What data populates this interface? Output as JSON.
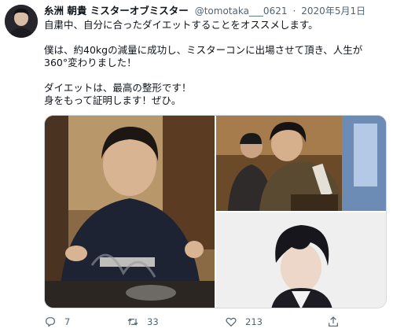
{
  "tweet": {
    "display_name": "糸洲 朝貴 ミスターオブミスター",
    "handle": "@tomotaka___0621",
    "separator": "·",
    "date": "2020年5月1日",
    "lines": [
      "自粛中、自分に合ったダイエットすることをオススメします。",
      "僕は、約40kgの減量に成功し、ミスターコンに出場させて頂き、人生が",
      "360°変わりました！",
      "ダイエットは、最高の整形です！",
      "身をもって証明します！ぜひ。"
    ],
    "media": [
      {
        "desc_icon": "photo-man-grilling"
      },
      {
        "desc_icon": "photo-friends-drinking"
      },
      {
        "desc_icon": "photo-styled-portrait"
      }
    ]
  },
  "actions": {
    "reply_icon": "reply-icon",
    "reply_count": "7",
    "retweet_icon": "retweet-icon",
    "retweet_count": "33",
    "like_icon": "heart-icon",
    "like_count": "213",
    "share_icon": "share-icon"
  },
  "colors": {
    "text": "#0f1419",
    "secondary": "#536471",
    "border": "#cfd9de"
  }
}
